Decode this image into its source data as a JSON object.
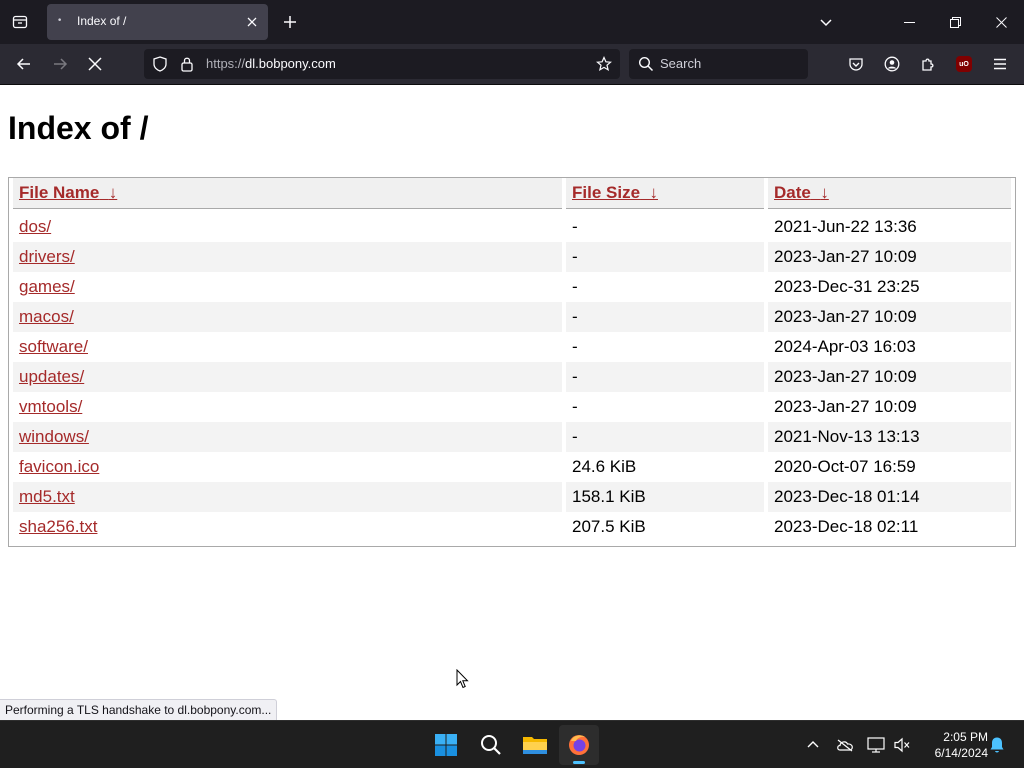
{
  "browser": {
    "tab": {
      "title": "Index of /"
    },
    "url": {
      "scheme": "https://",
      "host": "dl.bobpony.com"
    },
    "search": {
      "placeholder": "Search"
    }
  },
  "page": {
    "heading": "Index of /",
    "columns": {
      "name": "File Name",
      "size": "File Size",
      "date": "Date",
      "sort_indicator": "↓"
    },
    "rows": [
      {
        "name": "dos/",
        "size": "-",
        "date": "2021-Jun-22 13:36"
      },
      {
        "name": "drivers/",
        "size": "-",
        "date": "2023-Jan-27 10:09"
      },
      {
        "name": "games/",
        "size": "-",
        "date": "2023-Dec-31 23:25"
      },
      {
        "name": "macos/",
        "size": "-",
        "date": "2023-Jan-27 10:09"
      },
      {
        "name": "software/",
        "size": "-",
        "date": "2024-Apr-03 16:03"
      },
      {
        "name": "updates/",
        "size": "-",
        "date": "2023-Jan-27 10:09"
      },
      {
        "name": "vmtools/",
        "size": "-",
        "date": "2023-Jan-27 10:09"
      },
      {
        "name": "windows/",
        "size": "-",
        "date": "2021-Nov-13 13:13"
      },
      {
        "name": "favicon.ico",
        "size": "24.6 KiB",
        "date": "2020-Oct-07 16:59"
      },
      {
        "name": "md5.txt",
        "size": "158.1 KiB",
        "date": "2023-Dec-18 01:14"
      },
      {
        "name": "sha256.txt",
        "size": "207.5 KiB",
        "date": "2023-Dec-18 02:11"
      }
    ]
  },
  "status": {
    "text": "Performing a TLS handshake to dl.bobpony.com..."
  },
  "taskbar": {
    "time": "2:05 PM",
    "date": "6/14/2024",
    "apps": [
      "start-icon",
      "search-icon",
      "file-explorer-icon",
      "firefox-icon"
    ]
  },
  "colors": {
    "link": "#a52a2a",
    "tabbar_bg": "#1c1b22",
    "navbar_bg": "#2b2a33",
    "taskbar_bg": "#1f1f1f",
    "accent": "#4cc2ff"
  }
}
